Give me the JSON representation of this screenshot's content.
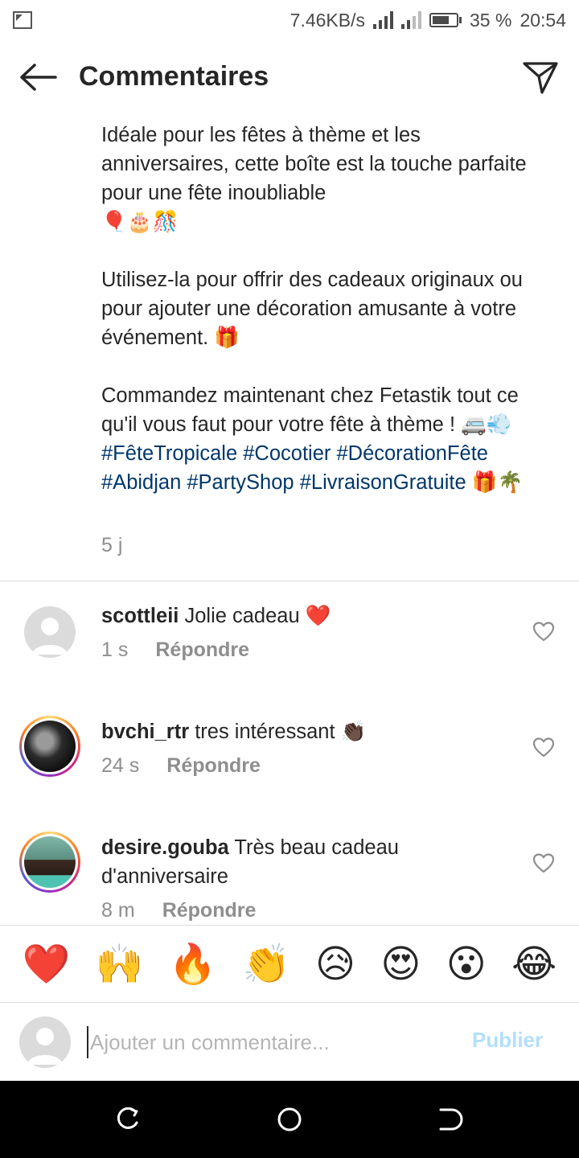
{
  "status_bar": {
    "speed": "7.46KB/s",
    "battery": "35 %",
    "time": "20:54"
  },
  "header": {
    "title": "Commentaires"
  },
  "caption": {
    "p1": "Idéale pour les fêtes à thème et les anniversaires, cette boîte est la touche parfaite pour une fête inoubliable",
    "p1_emojis": "🎈🎂🎊",
    "p2": "Utilisez-la pour offrir des cadeaux originaux ou pour ajouter une décoration amusante à votre événement.",
    "p2_emoji": "🎁",
    "p3": "Commandez maintenant chez Fetastik tout ce qu'il vous faut pour votre fête à thème !",
    "p3_emojis": "🚐💨",
    "hashtags": [
      "#FêteTropicale",
      "#Cocotier",
      "#DécorationFête",
      "#Abidjan",
      "#PartyShop",
      "#LivraisonGratuite"
    ],
    "end_emojis": "🎁🌴",
    "time": "5 j"
  },
  "comments": [
    {
      "username": "scottleii",
      "text": "Jolie cadeau",
      "emoji": "❤️",
      "time": "1 s",
      "reply_label": "Répondre"
    },
    {
      "username": "bvchi_rtr",
      "text": "tres intéressant",
      "emoji": "👏🏿",
      "time": "24 s",
      "reply_label": "Répondre"
    },
    {
      "username": "desire.gouba",
      "text": "Très beau cadeau d'anniversaire",
      "emoji": "",
      "time": "8 m",
      "reply_label": "Répondre"
    }
  ],
  "reactions": [
    "❤️",
    "🙌",
    "🔥",
    "👏",
    "😥",
    "😍",
    "😮",
    "😂"
  ],
  "composer": {
    "placeholder": "Ajouter un commentaire...",
    "publish_label": "Publier"
  },
  "colors": {
    "hashtag": "#00376b",
    "secondary_text": "#8e8e8e",
    "publish_disabled": "#b2dffc"
  }
}
